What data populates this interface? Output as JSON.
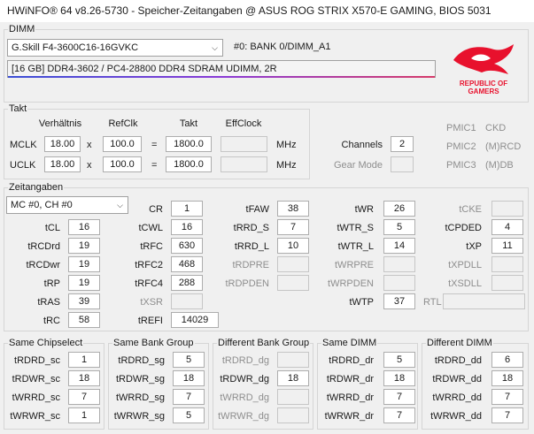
{
  "window": {
    "title": "HWiNFO® 64 v8.26-5730 - Speicher-Zeitangaben @ ASUS ROG STRIX X570-E GAMING, BIOS 5031"
  },
  "dimm": {
    "group_label": "DIMM",
    "module_select": "G.Skill F4-3600C16-16GVKC",
    "bank_label": "#0: BANK 0/DIMM_A1",
    "info": "[16 GB] DDR4-3602 / PC4-28800 DDR4 SDRAM UDIMM, 2R",
    "logo_text": [
      "REPUBLIC OF",
      "GAMERS"
    ],
    "logo_color": "#e8112d"
  },
  "takt": {
    "group_label": "Takt",
    "headers": {
      "ratio": "Verhältnis",
      "refclk": "RefClk",
      "takt": "Takt",
      "effclock": "EffClock"
    },
    "rows": [
      {
        "name": "MCLK",
        "ratio": "18.00",
        "x": "x",
        "refclk": "100.0",
        "eq": "=",
        "takt": "1800.0",
        "effclock": "",
        "unit": "MHz"
      },
      {
        "name": "UCLK",
        "ratio": "18.00",
        "x": "x",
        "refclk": "100.0",
        "eq": "=",
        "takt": "1800.0",
        "effclock": "",
        "unit": "MHz"
      }
    ],
    "channels_label": "Channels",
    "channels_value": "2",
    "gearmode_label": "Gear Mode",
    "gearmode_value": "",
    "pmic": [
      {
        "label": "PMIC1",
        "value": "CKD"
      },
      {
        "label": "PMIC2",
        "value": "(M)RCD"
      },
      {
        "label": "PMIC3",
        "value": "(M)DB"
      }
    ]
  },
  "timings": {
    "group_label": "Zeitangaben",
    "channel_select": "MC #0, CH #0",
    "tCL": {
      "label": "tCL",
      "value": "16"
    },
    "tRCDrd": {
      "label": "tRCDrd",
      "value": "19"
    },
    "tRCDwr": {
      "label": "tRCDwr",
      "value": "19"
    },
    "tRP": {
      "label": "tRP",
      "value": "19"
    },
    "tRAS": {
      "label": "tRAS",
      "value": "39"
    },
    "tRC": {
      "label": "tRC",
      "value": "58"
    },
    "CR": {
      "label": "CR",
      "value": "1"
    },
    "tCWL": {
      "label": "tCWL",
      "value": "16"
    },
    "tRFC": {
      "label": "tRFC",
      "value": "630"
    },
    "tRFC2": {
      "label": "tRFC2",
      "value": "468"
    },
    "tRFC4": {
      "label": "tRFC4",
      "value": "288"
    },
    "tXSR": {
      "label": "tXSR",
      "value": ""
    },
    "tREFI": {
      "label": "tREFI",
      "value": "14029"
    },
    "tFAW": {
      "label": "tFAW",
      "value": "38"
    },
    "tRRD_S": {
      "label": "tRRD_S",
      "value": "7"
    },
    "tRRD_L": {
      "label": "tRRD_L",
      "value": "10"
    },
    "tRDPRE": {
      "label": "tRDPRE",
      "value": ""
    },
    "tRDPDEN": {
      "label": "tRDPDEN",
      "value": ""
    },
    "tWR": {
      "label": "tWR",
      "value": "26"
    },
    "tWTR_S": {
      "label": "tWTR_S",
      "value": "5"
    },
    "tWTR_L": {
      "label": "tWTR_L",
      "value": "14"
    },
    "tWRPRE": {
      "label": "tWRPRE",
      "value": ""
    },
    "tWRPDEN": {
      "label": "tWRPDEN",
      "value": ""
    },
    "tWTP": {
      "label": "tWTP",
      "value": "37"
    },
    "RTL": {
      "label": "RTL",
      "value": ""
    },
    "tCKE": {
      "label": "tCKE",
      "value": ""
    },
    "tCPDED": {
      "label": "tCPDED",
      "value": "4"
    },
    "tXP": {
      "label": "tXP",
      "value": "11"
    },
    "tXPDLL": {
      "label": "tXPDLL",
      "value": ""
    },
    "tXSDLL": {
      "label": "tXSDLL",
      "value": ""
    }
  },
  "groups": [
    {
      "title": "Same Chipselect",
      "rows": [
        {
          "label": "tRDRD_sc",
          "value": "1"
        },
        {
          "label": "tRDWR_sc",
          "value": "18"
        },
        {
          "label": "tWRRD_sc",
          "value": "7"
        },
        {
          "label": "tWRWR_sc",
          "value": "1"
        }
      ]
    },
    {
      "title": "Same Bank Group",
      "rows": [
        {
          "label": "tRDRD_sg",
          "value": "5"
        },
        {
          "label": "tRDWR_sg",
          "value": "18"
        },
        {
          "label": "tWRRD_sg",
          "value": "7"
        },
        {
          "label": "tWRWR_sg",
          "value": "5"
        }
      ]
    },
    {
      "title": "Different Bank Group",
      "rows": [
        {
          "label": "tRDRD_dg",
          "value": ""
        },
        {
          "label": "tRDWR_dg",
          "value": "18"
        },
        {
          "label": "tWRRD_dg",
          "value": ""
        },
        {
          "label": "tWRWR_dg",
          "value": ""
        }
      ]
    },
    {
      "title": "Same DIMM",
      "rows": [
        {
          "label": "tRDRD_dr",
          "value": "5"
        },
        {
          "label": "tRDWR_dr",
          "value": "18"
        },
        {
          "label": "tWRRD_dr",
          "value": "7"
        },
        {
          "label": "tWRWR_dr",
          "value": "7"
        }
      ]
    },
    {
      "title": "Different DIMM",
      "rows": [
        {
          "label": "tRDRD_dd",
          "value": "6"
        },
        {
          "label": "tRDWR_dd",
          "value": "18"
        },
        {
          "label": "tWRRD_dd",
          "value": "7"
        },
        {
          "label": "tWRWR_dd",
          "value": "7"
        }
      ]
    }
  ]
}
